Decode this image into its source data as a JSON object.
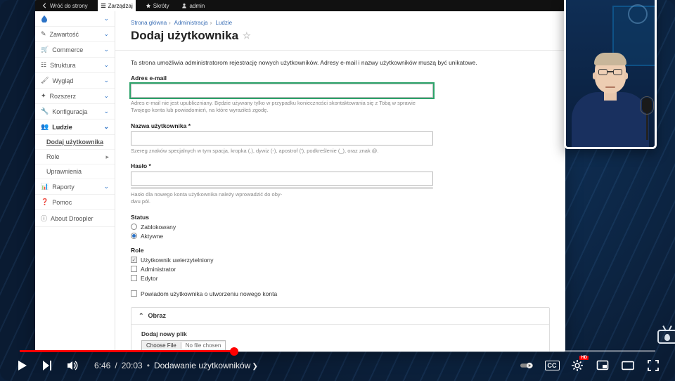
{
  "topbar": {
    "back": "Wróć do strony",
    "manage": "Zarządzaj",
    "shortcuts": "Skróty",
    "user": "admin"
  },
  "sidebar": {
    "items": [
      {
        "label": "",
        "icon": "home"
      },
      {
        "label": "Zawartość",
        "icon": "pencil"
      },
      {
        "label": "Commerce",
        "icon": "cart"
      },
      {
        "label": "Struktura",
        "icon": "structure"
      },
      {
        "label": "Wygląd",
        "icon": "brush"
      },
      {
        "label": "Rozszerz",
        "icon": "puzzle"
      },
      {
        "label": "Konfiguracja",
        "icon": "wrench"
      },
      {
        "label": "Ludzie",
        "icon": "people",
        "selected": true
      },
      {
        "label": "Raporty",
        "icon": "chart"
      },
      {
        "label": "Pomoc",
        "icon": "help"
      },
      {
        "label": "About Droopler",
        "icon": "info"
      }
    ],
    "subitems": [
      {
        "label": "Dodaj użytkownika",
        "active": true
      },
      {
        "label": "Role"
      },
      {
        "label": "Uprawnienia"
      }
    ]
  },
  "breadcrumb": {
    "a": "Strona główna",
    "b": "Administracja",
    "c": "Ludzie"
  },
  "page": {
    "title": "Dodaj użytkownika",
    "intro": "Ta strona umożliwia administratorom rejestrację nowych użytkowników. Adresy e-mail i nazwy użytkowników muszą być unikatowe.",
    "email_label": "Adres e-mail",
    "email_help": "Adres e-mail nie jest upubliczniany. Będzie używany tylko w przypadku konieczności skontaktowania się z Tobą w sprawie Twojego konta lub powiadomień, na które wyraziłeś zgodę.",
    "username_label": "Nazwa użytkownika",
    "username_help": "Szereg znaków specjalnych w tym spacja, kropka (.), dywiz (-), apostrof ('), podkreślenie (_), oraz znak @.",
    "password_label": "Hasło",
    "password_help": "Hasło dla nowego konta użytkownika należy wprowadzić do oby-\ndwu pól.",
    "status_label": "Status",
    "status_blocked": "Zablokowany",
    "status_active": "Aktywne",
    "roles_label": "Role",
    "role_auth": "Użytkownik uwierzytelniony",
    "role_admin": "Administrator",
    "role_editor": "Edytor",
    "notify": "Powiadom użytkownika o utworzeniu nowego konta",
    "obraz": "Obraz",
    "add_file": "Dodaj nowy plik",
    "choose_file": "Choose File",
    "no_file": "No file chosen"
  },
  "player": {
    "progress_pct": 33.7,
    "time_current": "6:46",
    "time_total": "20:03",
    "chapter": "Dodawanie użytkowników",
    "cc": "CC",
    "hd": "HD"
  }
}
